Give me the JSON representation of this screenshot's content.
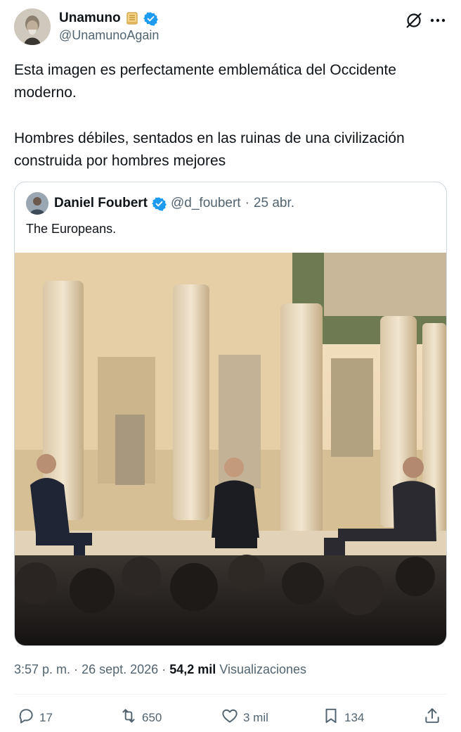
{
  "author": {
    "display_name": "Unamuno",
    "name_emoji": "scroll-emoji",
    "verified_icon": "verified-badge-icon",
    "handle": "@UnamunoAgain"
  },
  "header_actions": {
    "grok_icon": "grok-icon",
    "more_icon": "more-icon"
  },
  "tweet": {
    "paragraph_1": "Esta imagen es perfectamente emblemática del Occidente moderno.",
    "paragraph_2": "Hombres débiles, sentados en las ruinas de una civilización construida por hombres mejores"
  },
  "quote": {
    "display_name": "Daniel Foubert",
    "handle": "@d_foubert",
    "separator": "·",
    "date": "25 abr.",
    "text": "The Europeans."
  },
  "meta": {
    "time": "3:57 p. m.",
    "separator": "·",
    "date": "26 sept. 2026",
    "views_count": "54,2 mil",
    "views_label": "Visualizaciones"
  },
  "actions": {
    "replies": "17",
    "reposts": "650",
    "likes": "3 mil",
    "bookmarks": "134"
  },
  "colors": {
    "verified": "#1d9bf0",
    "secondary_text": "#536471",
    "border": "#cfd9de"
  }
}
